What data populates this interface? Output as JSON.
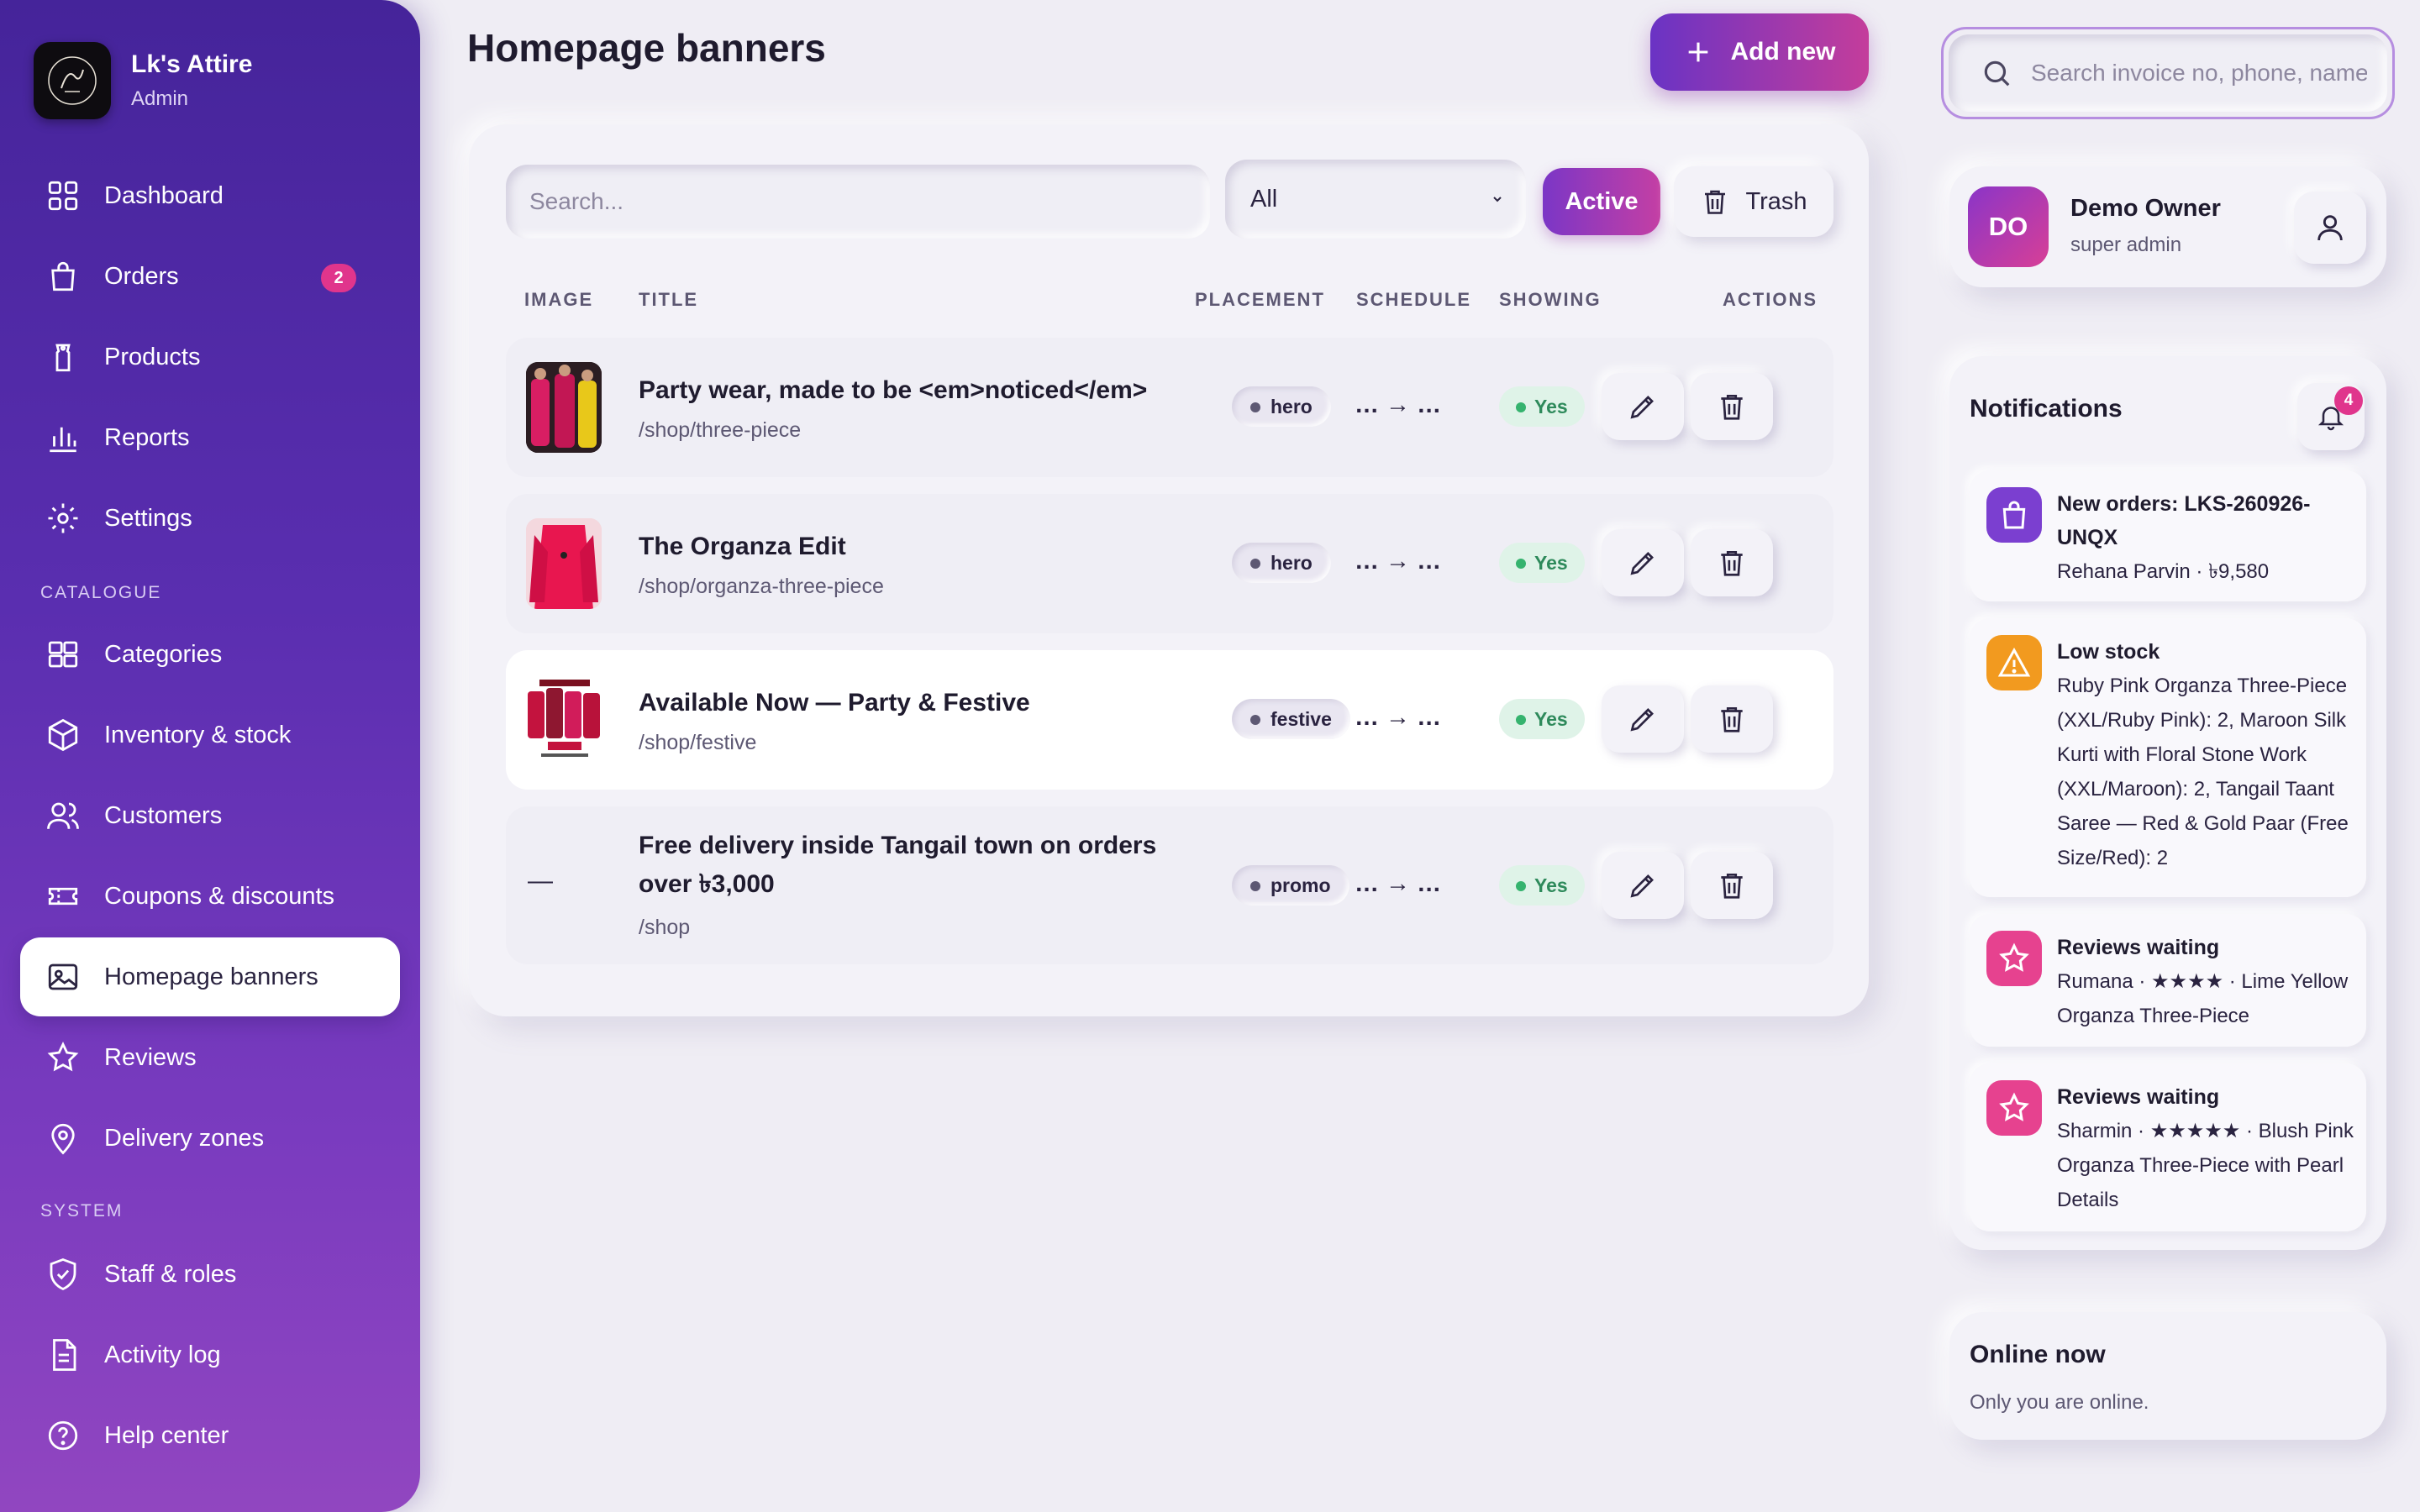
{
  "brand": {
    "name": "Lk's Attire",
    "role": "Admin"
  },
  "nav": {
    "items": [
      {
        "label": "Dashboard"
      },
      {
        "label": "Orders",
        "badge": "2"
      },
      {
        "label": "Products"
      },
      {
        "label": "Reports"
      },
      {
        "label": "Settings"
      }
    ],
    "catalogue_heading": "CATALOGUE",
    "catalogue": [
      {
        "label": "Categories"
      },
      {
        "label": "Inventory & stock"
      },
      {
        "label": "Customers"
      },
      {
        "label": "Coupons & discounts"
      },
      {
        "label": "Homepage banners"
      },
      {
        "label": "Reviews"
      },
      {
        "label": "Delivery zones"
      }
    ],
    "system_heading": "SYSTEM",
    "system": [
      {
        "label": "Staff & roles"
      },
      {
        "label": "Activity log"
      },
      {
        "label": "Help center"
      }
    ]
  },
  "page": {
    "title": "Homepage banners",
    "add_label": "Add new"
  },
  "filters": {
    "search_placeholder": "Search...",
    "status_options": [
      "All"
    ],
    "active_label": "Active",
    "trash_label": "Trash"
  },
  "table": {
    "headers": [
      "IMAGE",
      "TITLE",
      "PLACEMENT",
      "SCHEDULE",
      "SHOWING",
      "ACTIONS"
    ],
    "rows": [
      {
        "title": "Party wear, made to be <em>noticed</em>",
        "path": "/shop/three-piece",
        "placement": "hero",
        "schedule": "… → …",
        "showing": "Yes",
        "image": "photo"
      },
      {
        "title": "The Organza Edit",
        "path": "/shop/organza-three-piece",
        "placement": "hero",
        "schedule": "… → …",
        "showing": "Yes",
        "image": "photo"
      },
      {
        "title": "Available Now — Party & Festive",
        "path": "/shop/festive",
        "placement": "festive",
        "schedule": "… → …",
        "showing": "Yes",
        "image": "poster"
      },
      {
        "title": "Free delivery inside Tangail town on orders over ৳3,000",
        "path": "/shop",
        "placement": "promo",
        "schedule": "… → …",
        "showing": "Yes",
        "image_placeholder": "—"
      }
    ]
  },
  "header_search": {
    "placeholder": "Search invoice no, phone, name"
  },
  "profile": {
    "initials": "DO",
    "name": "Demo Owner",
    "role": "super admin"
  },
  "notifications": {
    "title": "Notifications",
    "count": "4",
    "items": [
      {
        "icon": "bag-icon",
        "color": "#7b3fd0",
        "title": "New orders: LKS-260926-UNQX",
        "body": "Rehana Parvin · ৳9,580"
      },
      {
        "icon": "warning-icon",
        "color": "#f29a1f",
        "title": "Low stock",
        "body": "Ruby Pink Organza Three-Piece (XXL/Ruby Pink): 2, Maroon Silk Kurti with Floral Stone Work (XXL/Maroon): 2, Tangail Taant Saree — Red & Gold Paar (Free Size/Red): 2"
      },
      {
        "icon": "star-icon",
        "color": "#e6428f",
        "title": "Reviews waiting",
        "body": "Rumana · ★★★★ · Lime Yellow Organza Three-Piece"
      },
      {
        "icon": "star-icon",
        "color": "#e6428f",
        "title": "Reviews waiting",
        "body": "Sharmin · ★★★★★ · Blush Pink Organza Three-Piece with Pearl Details"
      }
    ]
  },
  "online": {
    "title": "Online now",
    "subtitle": "Only you are online."
  },
  "colors": {
    "accent": "#7b36c6",
    "accent2": "#c43fa4",
    "sidebar_top": "#45249a",
    "sidebar_bottom": "#9146c0",
    "badge": "#e0358c",
    "success": "#35b36e"
  }
}
